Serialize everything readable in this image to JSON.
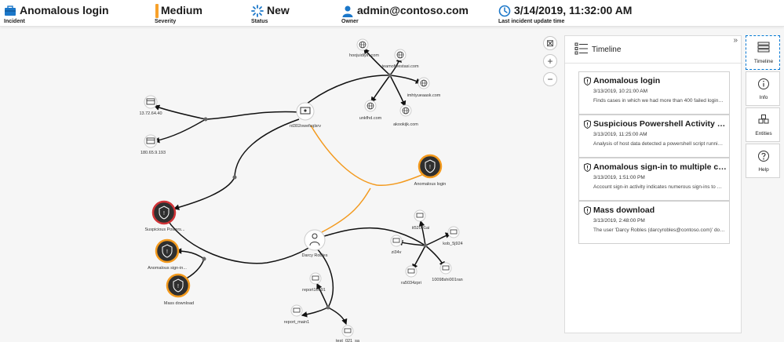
{
  "header": {
    "incident": {
      "value": "Anomalous login",
      "label": "Incident"
    },
    "severity": {
      "value": "Medium",
      "label": "Severity",
      "color": "#f7a12a"
    },
    "status": {
      "value": "New",
      "label": "Status"
    },
    "owner": {
      "value": "admin@contoso.com",
      "label": "Owner"
    },
    "updated": {
      "value": "3/14/2019, 11:32:00 AM",
      "label": "Last incident update time"
    }
  },
  "graph": {
    "nodes": {
      "rd30": "rd302owefsqlsrv",
      "ip1": "13.72.64.40",
      "ip2": "180.65.9.193",
      "dom1": "hoojuidiyin.com",
      "dom2": "teamofivestasi.com",
      "dom3": "imhtyueaask.com",
      "dom4": "unkfhd.com",
      "dom5": "akookijk.com",
      "alert_login": "Anomalous login",
      "alert_ps": "Suspicious Powers...",
      "alert_signin": "Anomalous sign-in...",
      "alert_mass": "Mass download",
      "user": "Darcy Robles",
      "it5": "it52001ai",
      "kob": "kob_5j924",
      "zi34": "zi34v",
      "ra50": "ra5034zpri",
      "m10098": "10098shi001ran",
      "report1": "report10991",
      "report2": "report_main1",
      "test": "test_021_sa"
    },
    "colors": {
      "edge": "#111111",
      "edge_highlight": "#f39a1e",
      "alert_ring": "#f39a1e",
      "alert_ring_red": "#d13438",
      "alert_fill": "#2f2f2f"
    }
  },
  "panel": {
    "title": "Timeline",
    "collapse_glyph": "»",
    "cards": [
      {
        "title": "Anomalous login",
        "time": "3/13/2019, 10:21:00 AM",
        "desc": "Finds cases in which we had more than 400 failed logins i..."
      },
      {
        "title": "Suspicious Powershell Activity Detec...",
        "time": "3/13/2019, 11:25:00 AM",
        "desc": "Analysis of host data detected a powershell script running..."
      },
      {
        "title": "Anomalous sign-in to multiple comp...",
        "time": "3/13/2019, 1:51:00 PM",
        "desc": "Account sign-in activity indicates numerous sign-ins to m..."
      },
      {
        "title": "Mass download",
        "time": "3/13/2019, 2:48:00 PM",
        "desc": "The user 'Darcy Robles (darcyrobles@contoso.com)' dow..."
      }
    ]
  },
  "rail": {
    "timeline": "Timeline",
    "info": "Info",
    "entities": "Entities",
    "help": "Help"
  },
  "zoom": {
    "fit": "⊠",
    "in": "+",
    "out": "−"
  }
}
